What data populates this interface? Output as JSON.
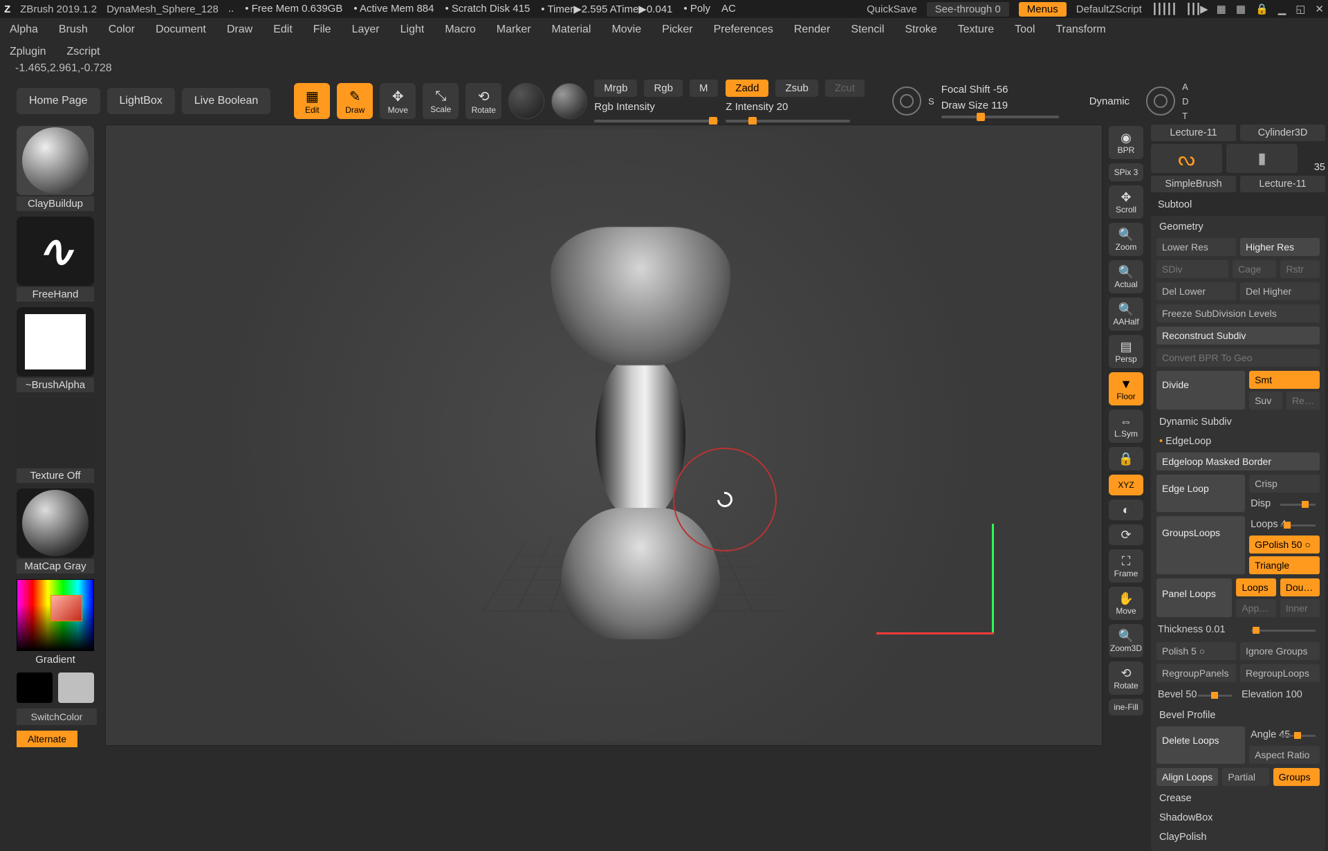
{
  "title": {
    "app": "ZBrush 2019.1.2",
    "doc": "DynaMesh_Sphere_128",
    "freemem": "Free Mem 0.639GB",
    "activemem": "Active Mem 884",
    "scratch": "Scratch Disk 415",
    "timer": "Timer▶2.595 ATime▶0.041",
    "poly": "Poly",
    "ac": "AC",
    "quicksave": "QuickSave",
    "see": "See-through  0",
    "menus": "Menus",
    "script": "DefaultZScript"
  },
  "menu": [
    "Alpha",
    "Brush",
    "Color",
    "Document",
    "Draw",
    "Edit",
    "File",
    "Layer",
    "Light",
    "Macro",
    "Marker",
    "Material",
    "Movie",
    "Picker",
    "Preferences",
    "Render",
    "Stencil",
    "Stroke",
    "Texture",
    "Tool",
    "Transform"
  ],
  "menu2": [
    "Zplugin",
    "Zscript"
  ],
  "coords": "-1.465,2.961,-0.728",
  "toolbar": {
    "home": "Home Page",
    "lightbox": "LightBox",
    "livebool": "Live Boolean",
    "modes": {
      "edit": "Edit",
      "draw": "Draw",
      "move": "Move",
      "scale": "Scale",
      "rotate": "Rotate"
    },
    "mrgb": "Mrgb",
    "rgb": "Rgb",
    "m": "M",
    "rgbint": "Rgb Intensity",
    "zadd": "Zadd",
    "zsub": "Zsub",
    "zcut": "Zcut",
    "zint": "Z Intensity 20",
    "focal": "Focal Shift -56",
    "drawsize": "Draw Size 119",
    "dynamic": "Dynamic",
    "s": "S",
    "a": "A",
    "d": "D",
    "t": "T"
  },
  "left": {
    "brush": "ClayBuildup",
    "stroke": "FreeHand",
    "alpha": "~BrushAlpha",
    "tex": "Texture Off",
    "mat": "MatCap Gray",
    "grad": "Gradient",
    "switch": "SwitchColor",
    "alt": "Alternate"
  },
  "rstrip": {
    "bpr": "BPR",
    "spix": "SPix 3",
    "scroll": "Scroll",
    "zoom": "Zoom",
    "actual": "Actual",
    "aahalf": "AAHalf",
    "persp": "Persp",
    "floor": "Floor",
    "lsym": "L.Sym",
    "lock": "",
    "xyz": "XYZ",
    "solo": "",
    "polyf": "",
    "frame": "Frame",
    "move": "Move",
    "zoom3d": "Zoom3D",
    "rotate": "Rotate",
    "linefill": "ine-Fill"
  },
  "right": {
    "tabs": {
      "a": "Lecture-11",
      "b": "Cylinder3D",
      "val": "35",
      "sb": "SimpleBrush",
      "c": "Lecture-11"
    },
    "subtool": "Subtool",
    "geo": "Geometry",
    "rows": {
      "lower": "Lower Res",
      "higher": "Higher Res",
      "sdiv": "SDiv",
      "cage": "Cage",
      "rstr": "Rstr",
      "dell": "Del Lower",
      "delh": "Del Higher",
      "freeze": "Freeze SubDivision Levels",
      "recon": "Reconstruct Subdiv",
      "bpr": "Convert BPR To Geo",
      "divide": "Divide",
      "smt": "Smt",
      "suv": "Suv",
      "reuv": "ReUV",
      "dynsub": "Dynamic Subdiv",
      "edgeloop": "EdgeLoop",
      "edgemask": "Edgeloop Masked Border",
      "eloop": "Edge Loop",
      "crisp": "Crisp",
      "disp": "Disp",
      "gloops": "GroupsLoops",
      "loops4": "Loops 4",
      "gpol": "GPolish 50",
      "tri": "Triangle",
      "ploops": "Panel Loops",
      "loops": "Loops",
      "double": "Double",
      "append": "Append",
      "inner": "Inner",
      "thick": "Thickness 0.01",
      "polish": "Polish 5",
      "ign": "Ignore Groups",
      "regp": "RegroupPanels",
      "regl": "RegroupLoops",
      "bev": "Bevel 50",
      "elev": "Elevation 100",
      "bprof": "Bevel Profile",
      "dloops": "Delete Loops",
      "angle": "Angle 45",
      "aspect": "Aspect Ratio",
      "aloops": "Align Loops",
      "partial": "Partial",
      "groups": "Groups",
      "crease": "Crease",
      "shadow": "ShadowBox",
      "clay": "ClayPolish"
    }
  }
}
